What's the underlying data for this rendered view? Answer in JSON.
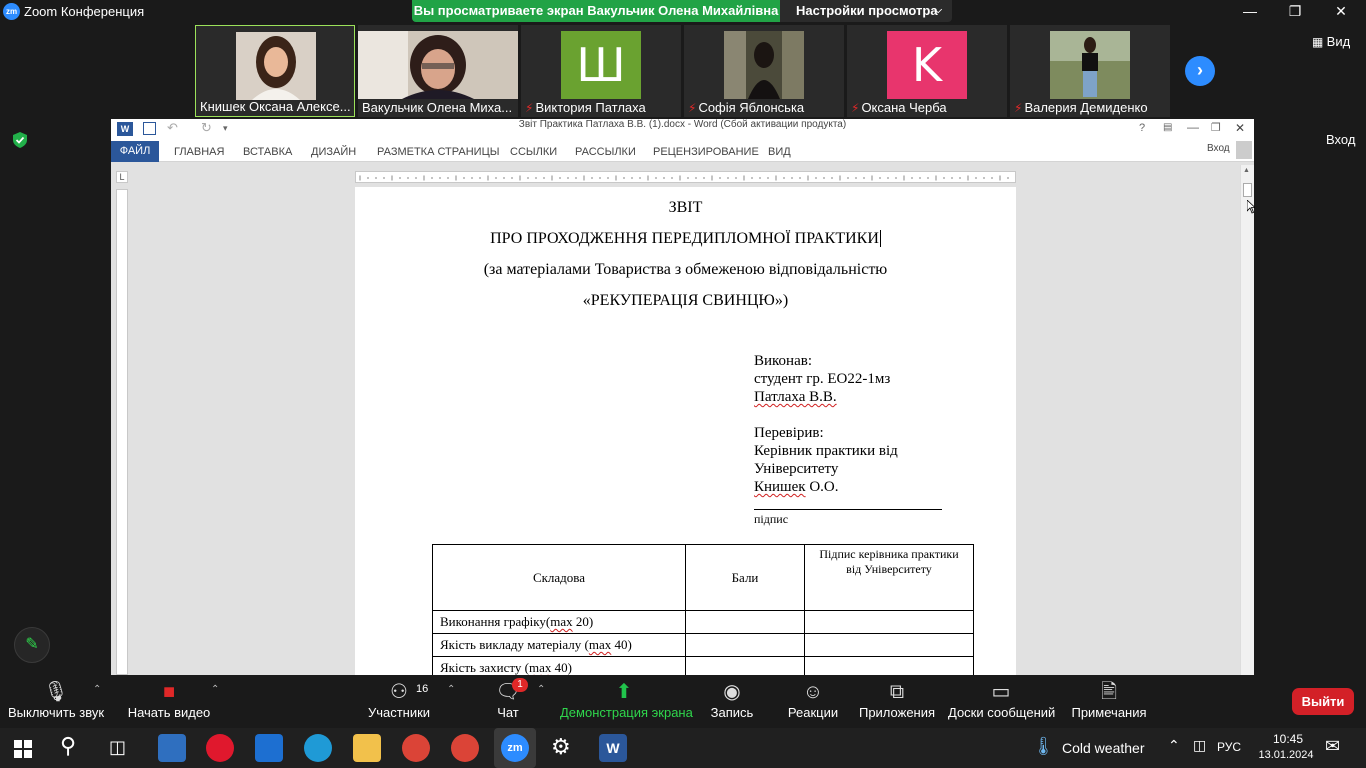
{
  "zoom": {
    "app_logo": "zm",
    "window_title": "Zoom Конференция",
    "share_banner": "Вы просматриваете экран Вакульчик Олена Михайлівна",
    "view_settings": "Настройки просмотра",
    "view_button": "Вид",
    "entry_label": "Вход",
    "participants": [
      {
        "name": "Книшек Оксана Алексе...",
        "type": "photo",
        "muted": false,
        "active": true
      },
      {
        "name": "Вакульчик Олена Миха...",
        "type": "photo",
        "muted": false,
        "active": false
      },
      {
        "name": "Виктория Патлаха",
        "type": "letter",
        "letter": "Ш",
        "color": "#6aa230",
        "muted": true
      },
      {
        "name": "Софія Яблонська",
        "type": "photo",
        "muted": true
      },
      {
        "name": "Оксана Черба",
        "type": "letter",
        "letter": "K",
        "color": "#e8356d",
        "muted": true
      },
      {
        "name": "Валерия Демиденко",
        "type": "photo",
        "muted": true
      }
    ],
    "toolbar": {
      "mute": "Выключить звук",
      "video": "Начать видео",
      "participants": "Участники",
      "participants_count": "16",
      "chat": "Чат",
      "chat_badge": "1",
      "share": "Демонстрация экрана",
      "record": "Запись",
      "reactions": "Реакции",
      "apps": "Приложения",
      "whiteboards": "Доски сообщений",
      "notes": "Примечания",
      "leave": "Выйти"
    },
    "colors": {
      "share_green": "#21a346",
      "accent_blue": "#2d8cff",
      "leave_red": "#d32027"
    }
  },
  "word": {
    "title": "Звіт Практика Патлаха В.В. (1).docx - Word (Сбой активации продукта)",
    "signin": "Вход",
    "tabs": [
      "ФАЙЛ",
      "ГЛАВНАЯ",
      "ВСТАВКА",
      "ДИЗАЙН",
      "РАЗМЕТКА СТРАНИЦЫ",
      "ССЫЛКИ",
      "РАССЫЛКИ",
      "РЕЦЕНЗИРОВАНИЕ",
      "ВИД"
    ],
    "ruler_corner": "L",
    "document": {
      "heading1": "ЗВІТ",
      "heading2": "ПРО ПРОХОДЖЕННЯ ПЕРЕДИПЛОМНОЇ ПРАКТИКИ",
      "heading3": "(за матеріалами Товариства з обмеженою відповідальністю",
      "heading4": "«РЕКУПЕРАЦІЯ СВИНЦЮ»)",
      "performed_label": "Виконав:",
      "student_group": "студент гр. ЕО22-1мз",
      "student_name": " Патлаха В.В.",
      "checked_label": "Перевірив:",
      "supervisor_line1": "Керівник практики від",
      "supervisor_line2": "Університету",
      "supervisor_name_a": "Книшек",
      "supervisor_name_b": " О.О.",
      "signature_label": "підпис",
      "table": {
        "headers": [
          "Складова",
          "Бали",
          "Підпис керівника практики від Університету"
        ],
        "rows": [
          {
            "a": "Виконання графіку(",
            "b": "max",
            "c": " 20)"
          },
          {
            "a": "Якість викладу матеріалу (",
            "b": "max",
            "c": " 40)"
          },
          {
            "a": "Якість захисту (",
            "b": "max",
            "c": " 40)"
          }
        ]
      }
    }
  },
  "taskbar": {
    "weather": "Cold weather",
    "language": "РУС",
    "time": "10:45",
    "date": "13.01.2024"
  }
}
